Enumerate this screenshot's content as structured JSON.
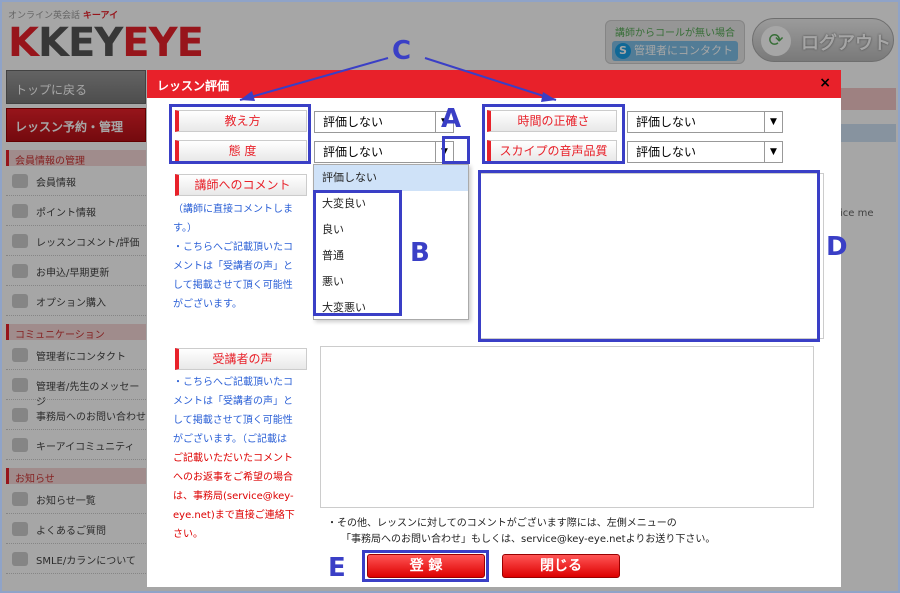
{
  "header": {
    "brand_sub": "オンライン英会話",
    "brand_sub_red": "キーアイ",
    "logo_k": "K",
    "logo_text": "KEY",
    "logo_eye": "EYE",
    "nocall_text": "講師からコールが無い場合",
    "contact_admin": "管理者にコンタクト",
    "logout": "ログアウト"
  },
  "sidebar": {
    "top_button": "トップに戻る",
    "lesson_button": "レッスン予約・管理",
    "sections": [
      {
        "title": "会員情報の管理",
        "items": [
          "会員情報",
          "ポイント情報",
          "レッスンコメント/評価",
          "お申込/早期更新",
          "オプション購入"
        ]
      },
      {
        "title": "コミュニケーション",
        "items": [
          "管理者にコンタクト",
          "管理者/先生のメッセージ",
          "事務局へのお問い合わせ",
          "キーアイコミュニティ"
        ]
      },
      {
        "title": "お知らせ",
        "items": [
          "お知らせ一覧",
          "よくあるご質問",
          "SMLE/カランについて"
        ]
      }
    ]
  },
  "background_right": {
    "text": "ice me"
  },
  "modal": {
    "title": "レッスン評価",
    "close": "×",
    "ratings": {
      "teaching": "教え方",
      "attitude": "態 度",
      "punctuality": "時間の正確さ",
      "skype_quality": "スカイプの音声品質",
      "default_value": "評価しない"
    },
    "dropdown_options": [
      "評価しない",
      "大変良い",
      "良い",
      "普通",
      "悪い",
      "大変悪い"
    ],
    "teacher_comment": {
      "label": "講師へのコメント",
      "note_lines": [
        "（講師に直接コメントしま",
        "す。）",
        "・こちらへご記載頂いたコ",
        "メントは「受講者の声」と",
        "して掲載させて頂く可能性",
        "がございます。"
      ]
    },
    "student_voice": {
      "label": "受講者の声",
      "note_blue_lines": [
        "・こちらへご記載頂いたコ",
        "メントは「受講者の声」と",
        "して掲載させて頂く可能性",
        "がございます。（ご記載は"
      ],
      "note_red_lines": [
        "ご記載いただいたコメント",
        "へのお返事をご希望の場合",
        "は、事務局(service@key-",
        "eye.net)まで直接ご連絡下",
        "さい。"
      ]
    },
    "footer_note_1": "・その他、レッスンに対してのコメントがございます際には、左側メニューの",
    "footer_note_2": "「事務局へのお問い合わせ」もしくは、service@key-eye.netよりお送り下さい。",
    "submit": "登 録",
    "close_button": "閉じる"
  },
  "annotations": {
    "A": "A",
    "B": "B",
    "C": "C",
    "D": "D",
    "E": "E"
  }
}
